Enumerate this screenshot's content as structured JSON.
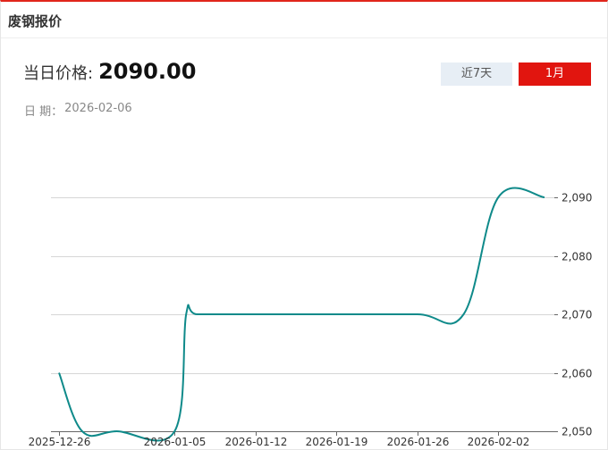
{
  "header": {
    "title": "废钢报价"
  },
  "price": {
    "label": "当日价格:",
    "value": "2090.00"
  },
  "date": {
    "label": "日 期：",
    "value": "2026-02-06"
  },
  "range_buttons": [
    {
      "label": "近7天",
      "active": false
    },
    {
      "label": "1月",
      "active": true
    }
  ],
  "colors": {
    "accent": "#e1150f",
    "line": "#0f8a8a",
    "inactive_button": "#e7eef5"
  },
  "chart_data": {
    "type": "line",
    "x": [
      "2025-12-26",
      "2025-12-28",
      "2025-12-31",
      "2026-01-05",
      "2026-01-06",
      "2026-01-07",
      "2026-01-12",
      "2026-01-19",
      "2026-01-26",
      "2026-01-30",
      "2026-02-02",
      "2026-02-06"
    ],
    "series": [
      {
        "values": [
          2060,
          2050,
          2050,
          2050,
          2070,
          2070,
          2070,
          2070,
          2070,
          2070,
          2090,
          2090
        ]
      }
    ],
    "xticks": [
      "2025-12-26",
      "2026-01-05",
      "2026-01-12",
      "2026-01-19",
      "2026-01-26",
      "2026-02-02"
    ],
    "yticks": [
      "2,050",
      "2,060",
      "2,070",
      "2,080",
      "2,090"
    ],
    "ylim": [
      2050,
      2090
    ],
    "xlim": [
      "2025-12-26",
      "2026-02-06"
    ],
    "grid": true,
    "legend": "none",
    "y_axis_position": "right"
  }
}
